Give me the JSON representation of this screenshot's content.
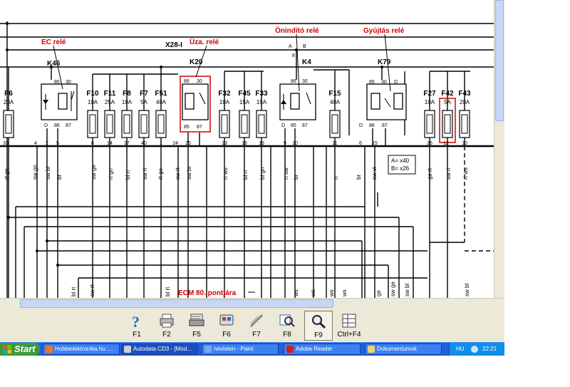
{
  "diagram": {
    "relay_annotations": {
      "ec": "EC relé",
      "uza": "Üza. relé",
      "onindito": "Önindító relé",
      "gyujtas": "Gyújtás relé"
    },
    "connector_label": "X28-I",
    "relays": {
      "k46": "K46",
      "k20": "K20",
      "k4": "K4",
      "k79": "K79"
    },
    "fuse_names": [
      "F6",
      "F10",
      "F11",
      "F8",
      "F7",
      "F51",
      "F32",
      "F45",
      "F33",
      "F15",
      "F27",
      "F42",
      "F43"
    ],
    "fuse_ratings": [
      "20A",
      "10A",
      "25A",
      "10A",
      "5A",
      "40A",
      "10A",
      "15A",
      "15A",
      "40A",
      "10A",
      "5A",
      "20A"
    ],
    "relay_pins": {
      "k46": [
        "85",
        "30",
        "86",
        "87",
        "D"
      ],
      "k20": [
        "86",
        "30",
        "85",
        "87"
      ],
      "k4": [
        "86",
        "30",
        "85",
        "87",
        "D"
      ],
      "k79": [
        "85",
        "30",
        "D",
        "86",
        "87",
        "D"
      ]
    },
    "terminal_numbers": [
      "33",
      "4",
      "2",
      "5",
      "6",
      "14",
      "37",
      "40",
      "1",
      "24",
      "25",
      "13",
      "16",
      "16",
      "9",
      "10",
      "11",
      "6",
      "15",
      "26",
      "12",
      "10"
    ],
    "terminal_extra": {
      "a": "A",
      "b": "B",
      "n8": "8"
    },
    "wire_colors": [
      "rt gn",
      "sw gn",
      "sw bl",
      "br",
      "sw ge",
      "rt gn",
      "bl rt",
      "sw rt",
      "rt ge",
      "sw rt",
      "sw br",
      "rt ws",
      "bl rt",
      "bl gn",
      "rt sw",
      "br",
      "rt",
      "br",
      "sw vi",
      "ge rt",
      "sw rt",
      "rt ws"
    ],
    "bottom_wire_labels": [
      "bl rt",
      "sw rt",
      "bl rt",
      "ws",
      "ws",
      "ws",
      "ws",
      "ge",
      "sw ge",
      "sw bl",
      "sw bl"
    ],
    "legend": {
      "line1": "A= x40",
      "line2": "B= x26"
    },
    "ecm_note": "ECM 80. pontjára"
  },
  "toolbar": {
    "buttons": [
      {
        "key": "F1",
        "icon": "help-icon"
      },
      {
        "key": "F2",
        "icon": "printer-icon"
      },
      {
        "key": "F5",
        "icon": "print-preview-icon"
      },
      {
        "key": "F6",
        "icon": "copy-icon"
      },
      {
        "key": "F7",
        "icon": "tools-icon"
      },
      {
        "key": "F8",
        "icon": "zoom-diagram-icon"
      },
      {
        "key": "F9",
        "icon": "magnifier-icon"
      },
      {
        "key": "Ctrl+F4",
        "icon": "table-icon"
      }
    ]
  },
  "taskbar": {
    "start_label": "Start",
    "tasks": [
      "Hobbielektronika.hu :...",
      "Autodata CD3 - [Mod...",
      "névtelen - Paint",
      "Adobe Reader",
      "Dokumentumok"
    ],
    "language": "HU",
    "clock": "22:21"
  },
  "colors": {
    "annotation_red": "#d00000",
    "taskbar_blue": "#245edb",
    "start_green": "#3c9a3c",
    "toolbar_bg": "#ece9d8"
  }
}
